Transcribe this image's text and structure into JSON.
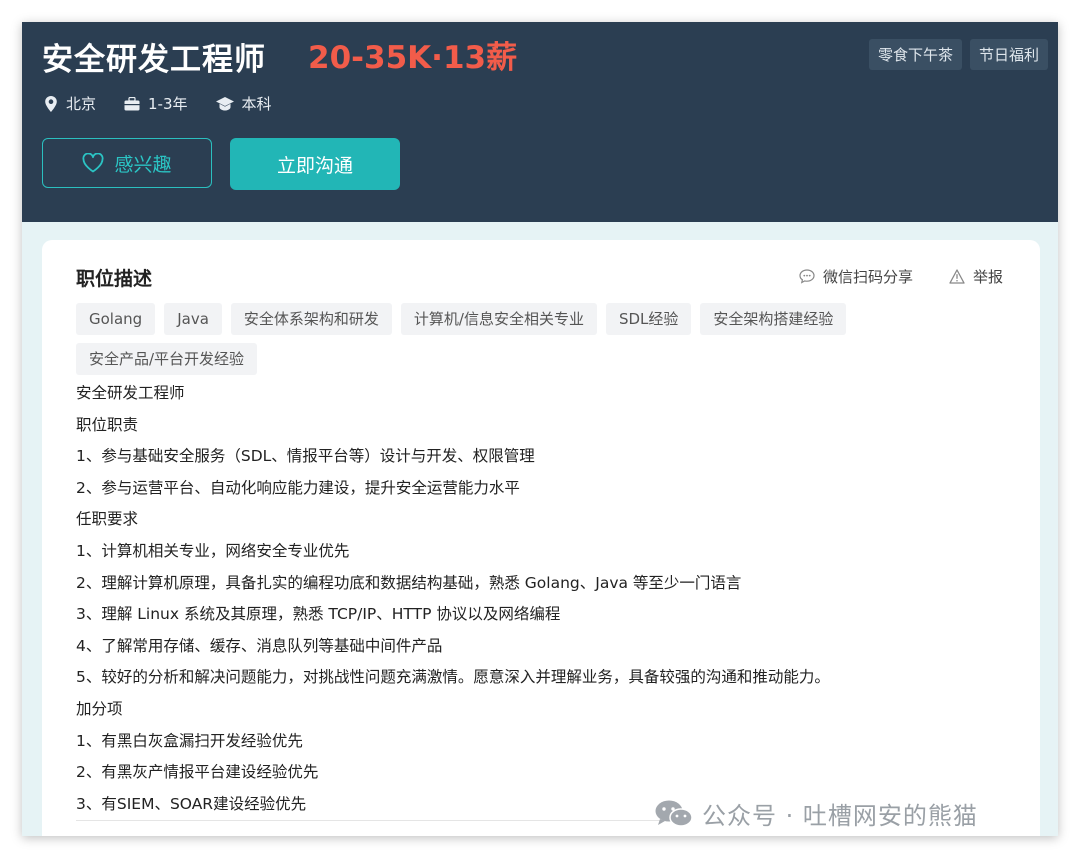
{
  "header": {
    "title": "安全研发工程师",
    "salary": "20-35K·13薪",
    "perks": [
      "零食下午茶",
      "节日福利"
    ],
    "meta": {
      "location": "北京",
      "experience": "1-3年",
      "education": "本科"
    },
    "interest_label": "感兴趣",
    "chat_label": "立即沟通"
  },
  "card": {
    "section_title": "职位描述",
    "share_label": "微信扫码分享",
    "report_label": "举报",
    "tags": [
      "Golang",
      "Java",
      "安全体系架构和研发",
      "计算机/信息安全相关专业",
      "SDL经验",
      "安全架构搭建经验",
      "安全产品/平台开发经验"
    ],
    "description": [
      "安全研发工程师",
      "职位职责",
      "1、参与基础安全服务（SDL、情报平台等）设计与开发、权限管理",
      "2、参与运营平台、自动化响应能力建设，提升安全运营能力水平",
      "任职要求",
      "1、计算机相关专业，网络安全专业优先",
      "2、理解计算机原理，具备扎实的编程功底和数据结构基础，熟悉 Golang、Java 等至少一门语言",
      "3、理解 Linux 系统及其原理，熟悉 TCP/IP、HTTP 协议以及网络编程",
      "4、了解常用存储、缓存、消息队列等基础中间件产品",
      "5、较好的分析和解决问题能力，对挑战性问题充满激情。愿意深入并理解业务，具备较强的沟通和推动能力。",
      "加分项",
      "1、有黑白灰盒漏扫开发经验优先",
      "2、有黑灰产情报平台建设经验优先",
      "3、有SIEM、SOAR建设经验优先"
    ]
  },
  "watermark": "公众号 · 吐槽网安的熊猫",
  "colors": {
    "header_bg": "#2b3e52",
    "salary": "#f25c4a",
    "accent": "#22b6b6"
  }
}
